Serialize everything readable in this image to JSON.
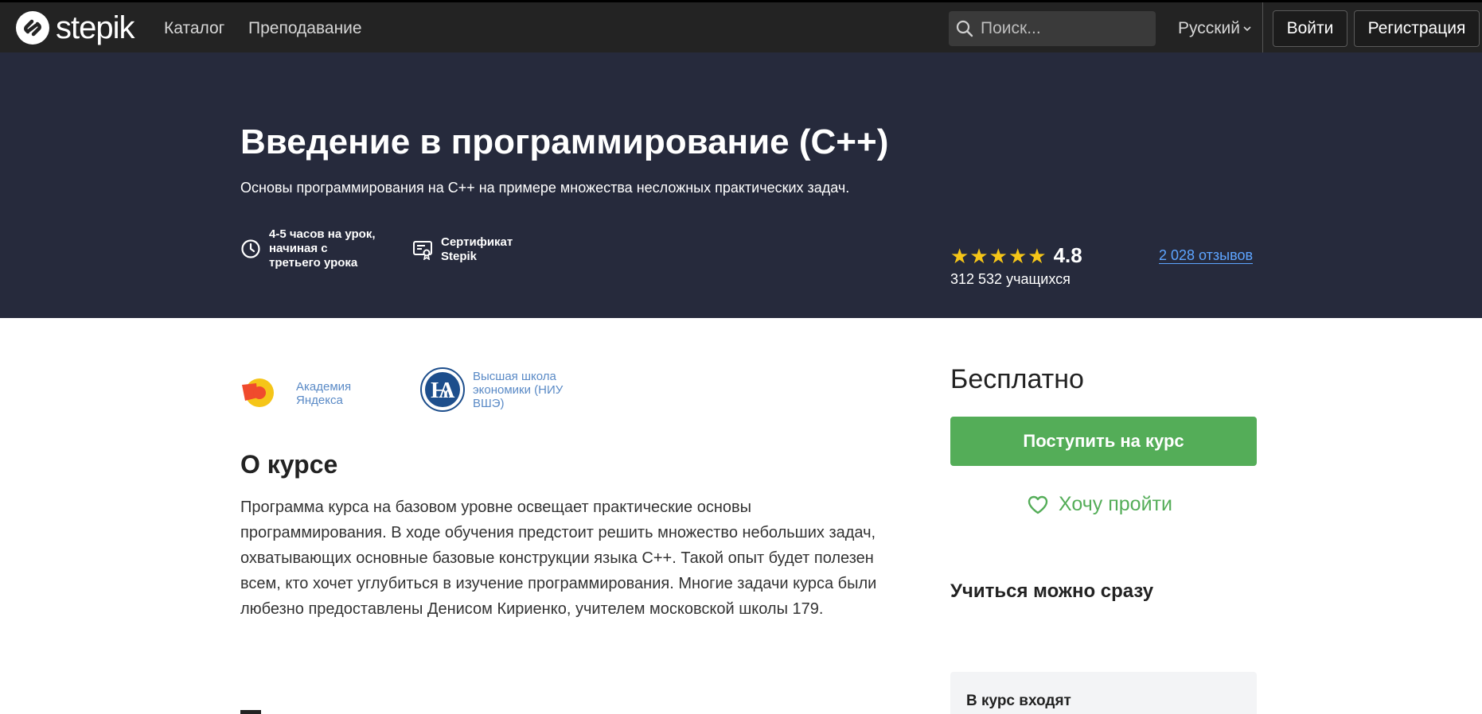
{
  "nav": {
    "logo_text": "stepik",
    "links": [
      "Каталог",
      "Преподавание"
    ],
    "search_placeholder": "Поиск...",
    "language": "Русский",
    "login": "Войти",
    "register": "Регистрация"
  },
  "hero": {
    "title": "Введение в программирование (C++)",
    "subtitle": "Основы программирования на C++ на примере множества несложных практических задач.",
    "workload": "4-5 часов на урок, начиная с третьего урока",
    "certificate": "Сертификат Stepik",
    "rating": "4.8",
    "stars": 5,
    "learners": "312 532 учащихся",
    "reviews": "2 028 отзывов"
  },
  "partners": [
    {
      "name": "Академия Яндекса",
      "icon": "yandex-academy-logo"
    },
    {
      "name": "Высшая школа экономики (НИУ ВШЭ)",
      "icon": "hse-logo"
    }
  ],
  "about": {
    "title": "О курсе",
    "text": "Программа курса на базовом уровне освещает практические основы программирования. В ходе обучения предстоит решить множество небольших задач, охватывающих основные базовые конструкции языка C++. Такой опыт будет полезен всем, кто хочет углубиться в изучение программирования. Многие задачи курса были любезно предоставлены Денисом Кириенко, учителем московской школы 179."
  },
  "sidebar": {
    "price": "Бесплатно",
    "enroll": "Поступить на курс",
    "wishlist": "Хочу пройти",
    "learn_now": "Учиться можно сразу",
    "includes_title": "В курс входят"
  },
  "colors": {
    "nav_bg": "#232323",
    "hero_bg": "#262a3c",
    "accent_green": "#54ad58",
    "link_blue": "#5da4ff",
    "star_yellow": "#f5c518"
  }
}
